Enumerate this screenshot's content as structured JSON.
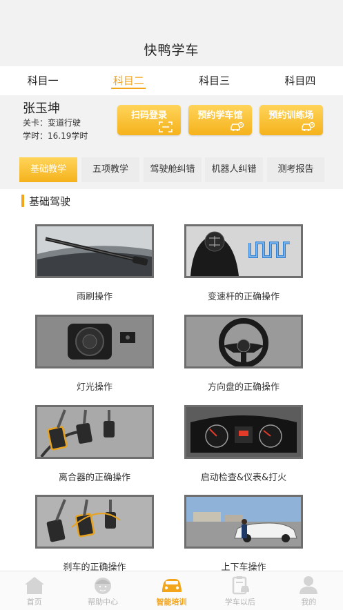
{
  "app": {
    "title": "快鸭学车"
  },
  "subject_tabs": [
    {
      "label": "科目一",
      "active": false
    },
    {
      "label": "科目二",
      "active": true
    },
    {
      "label": "科目三",
      "active": false
    },
    {
      "label": "科目四",
      "active": false
    }
  ],
  "user": {
    "name": "张玉坤",
    "level_label": "关卡：",
    "level_value": "变道行驶",
    "hours_label": "学时：",
    "hours_value": "16.19学时"
  },
  "actions": [
    {
      "label": "扫码登录",
      "icon": "scan-icon"
    },
    {
      "label": "预约学车馆",
      "icon": "car-clock-icon"
    },
    {
      "label": "预约训练场",
      "icon": "car-clock-icon"
    }
  ],
  "training_tabs": [
    {
      "label": "基础教学",
      "active": true
    },
    {
      "label": "五项教学",
      "active": false
    },
    {
      "label": "驾驶舱纠错",
      "active": false
    },
    {
      "label": "机器人纠错",
      "active": false
    },
    {
      "label": "测考报告",
      "active": false
    }
  ],
  "section": {
    "title": "基础驾驶"
  },
  "lessons": [
    {
      "caption": "雨刷操作",
      "image": "wiper-image"
    },
    {
      "caption": "变速杆的正确操作",
      "image": "gear-shift-image"
    },
    {
      "caption": "灯光操作",
      "image": "light-switch-image"
    },
    {
      "caption": "方向盘的正确操作",
      "image": "steering-wheel-image"
    },
    {
      "caption": "离合器的正确操作",
      "image": "clutch-pedal-image"
    },
    {
      "caption": "启动检查&仪表&打火",
      "image": "dashboard-image"
    },
    {
      "caption": "刹车的正确操作",
      "image": "brake-pedal-image"
    },
    {
      "caption": "上下车操作",
      "image": "car-entry-image"
    }
  ],
  "bottom_nav": [
    {
      "label": "首页",
      "icon": "home-icon",
      "active": false
    },
    {
      "label": "帮助中心",
      "icon": "help-face-icon",
      "active": false
    },
    {
      "label": "智能培训",
      "icon": "smart-car-icon",
      "active": true
    },
    {
      "label": "学车以后",
      "icon": "clipboard-car-icon",
      "active": false
    },
    {
      "label": "我的",
      "icon": "person-icon",
      "active": false
    }
  ],
  "colors": {
    "accent": "#f2a41a",
    "button_top": "#ffd45a",
    "button_bottom": "#f5b21c",
    "band": "#f2f2f2"
  }
}
